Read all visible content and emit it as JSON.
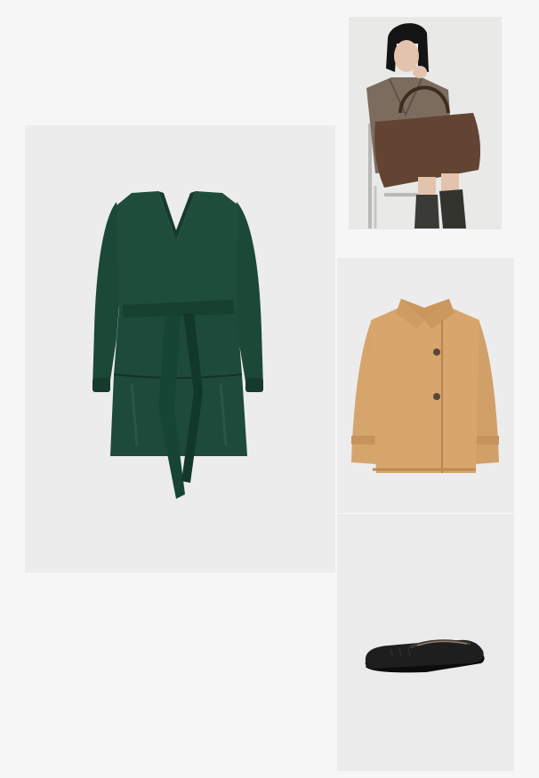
{
  "outfit": {
    "items": [
      {
        "id": "dress",
        "icon": "wrap-dress-image",
        "color": "#1f4a3a"
      },
      {
        "id": "bag-model",
        "icon": "model-with-bag-image",
        "color": "#5b3e2e"
      },
      {
        "id": "jacket",
        "icon": "short-coat-image",
        "color": "#d8a66c"
      },
      {
        "id": "shoe",
        "icon": "ballet-flat-image",
        "color": "#1b1b1b"
      }
    ]
  }
}
